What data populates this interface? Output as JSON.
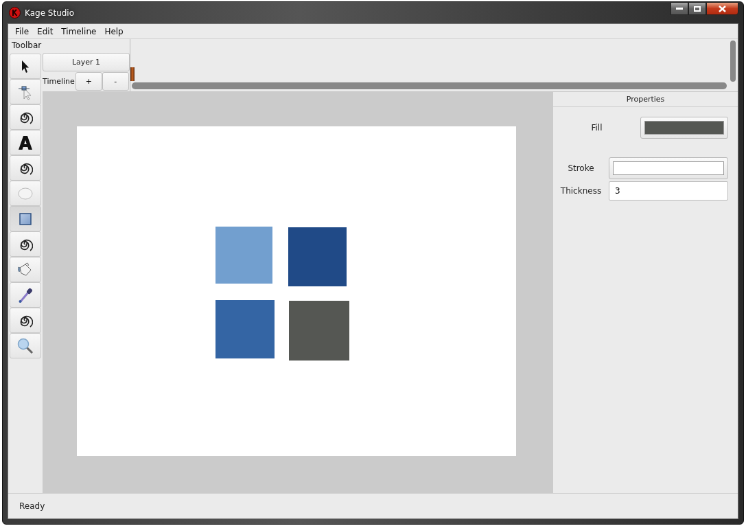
{
  "window": {
    "title": "Kage Studio"
  },
  "menu": [
    "File",
    "Edit",
    "Timeline",
    "Help"
  ],
  "toolbar": {
    "label": "Toolbar",
    "tools": [
      {
        "kind": "select",
        "selected": false
      },
      {
        "kind": "node",
        "selected": false
      },
      {
        "kind": "spiral",
        "selected": false
      },
      {
        "kind": "text",
        "selected": false
      },
      {
        "kind": "spiral",
        "selected": false
      },
      {
        "kind": "ellipse",
        "selected": false
      },
      {
        "kind": "rectangle",
        "selected": true
      },
      {
        "kind": "spiral",
        "selected": false
      },
      {
        "kind": "fill",
        "selected": false
      },
      {
        "kind": "dropper",
        "selected": false
      },
      {
        "kind": "spiral",
        "selected": false
      },
      {
        "kind": "zoom",
        "selected": false
      }
    ]
  },
  "timeline": {
    "layers": [
      "Layer 1"
    ],
    "label": "Timeline",
    "add": "+",
    "remove": "-"
  },
  "canvas": {
    "shapes": [
      {
        "color": "#729fcf"
      },
      {
        "color": "#204a87"
      },
      {
        "color": "#3465a4"
      },
      {
        "color": "#555753"
      }
    ]
  },
  "properties": {
    "title": "Properties",
    "fill": {
      "label": "Fill",
      "color": "#555753"
    },
    "stroke": {
      "label": "Stroke",
      "color": "#ffffff"
    },
    "thickness": {
      "label": "Thickness",
      "value": "3"
    }
  },
  "status_bar": "Ready"
}
